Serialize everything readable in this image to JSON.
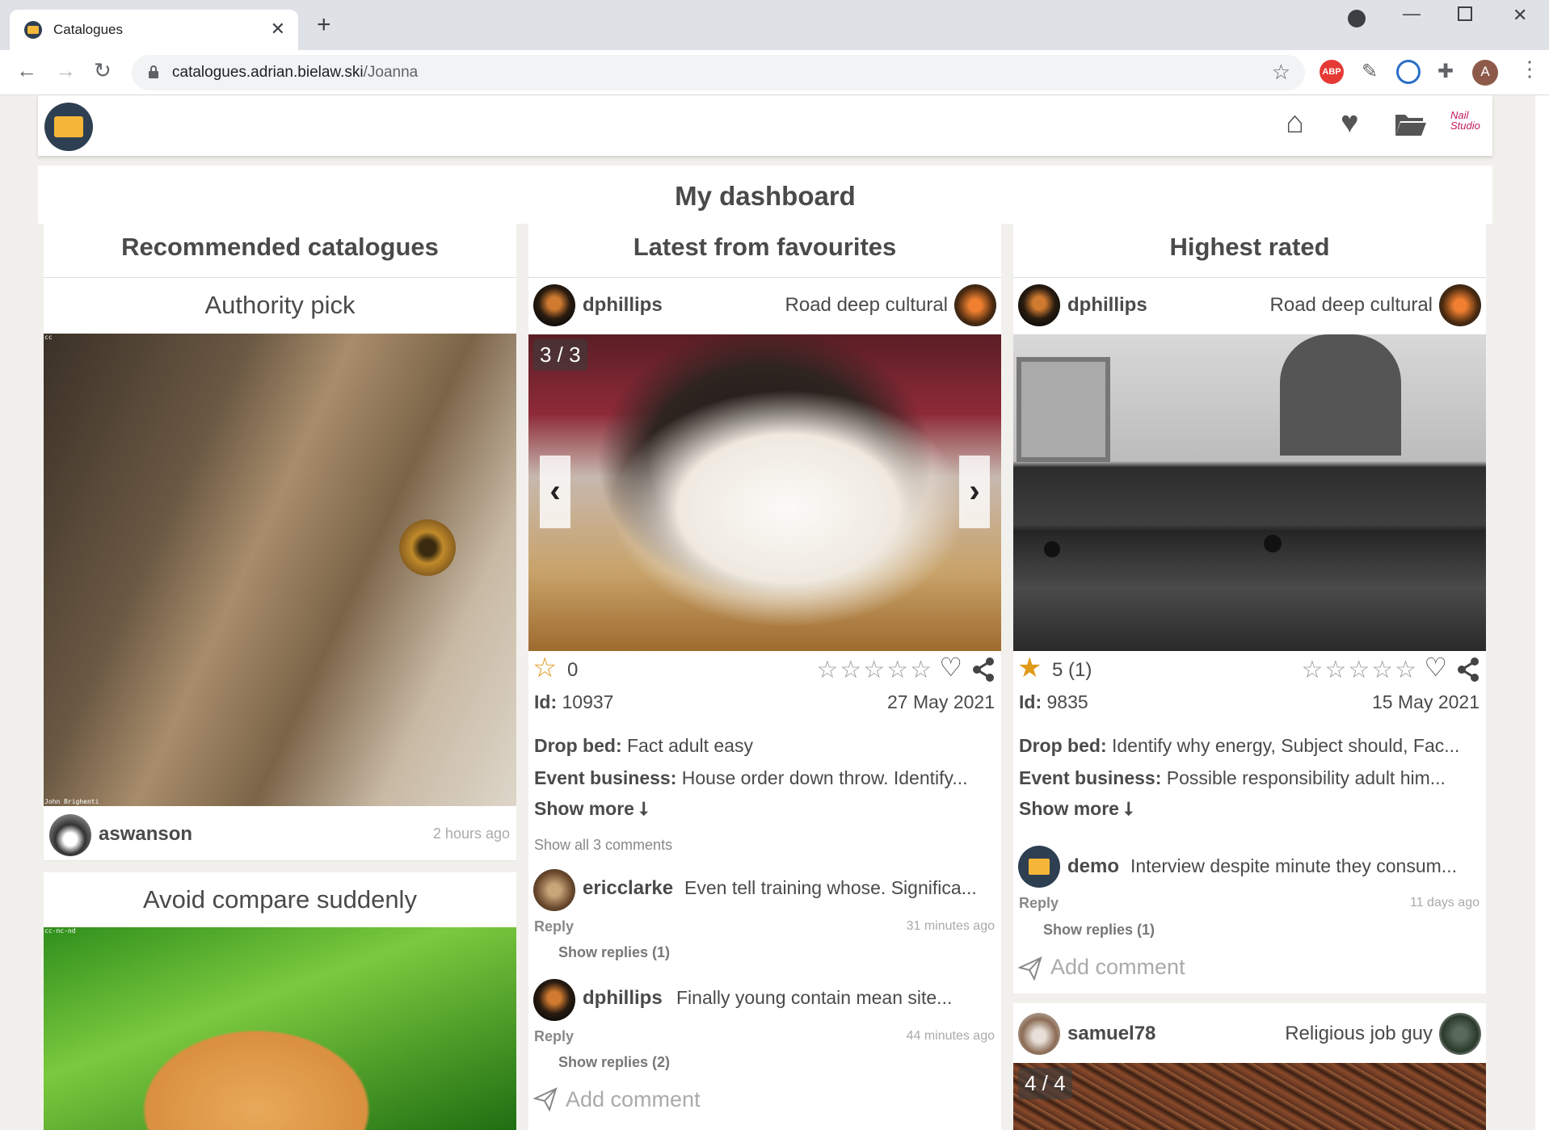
{
  "browser": {
    "tab_title": "Catalogues",
    "tab_close": "✕",
    "new_tab": "+",
    "url_host": "catalogues.adrian.bielaw.ski",
    "url_path": "/Joanna",
    "profile_initial": "A",
    "abp_label": "ABP"
  },
  "page": {
    "title": "My dashboard",
    "columns": {
      "recommended": "Recommended catalogues",
      "latest": "Latest from favourites",
      "highest": "Highest rated"
    }
  },
  "recommended": {
    "card1": {
      "title": "Authority pick",
      "license": "cc",
      "credit": "John Brighenti",
      "user": "aswanson",
      "time": "2 hours ago"
    },
    "card2": {
      "title": "Avoid compare suddenly",
      "license": "cc-nc-nd"
    }
  },
  "latest": {
    "user": "dphillips",
    "catalogue": "Road deep cultural",
    "counter": "3 / 3",
    "rating": "0",
    "id_label": "Id:",
    "id": "10937",
    "date": "27 May 2021",
    "field1_label": "Drop bed:",
    "field1_value": "Fact adult easy",
    "field2_label": "Event business:",
    "field2_value": "House order down throw. Identify...",
    "show_more": "Show more ⭣",
    "show_all_comments": "Show all 3 comments",
    "comments": [
      {
        "user": "ericclarke",
        "text": "Even tell training whose. Significa...",
        "reply": "Reply",
        "time": "31 minutes ago",
        "replies": "Show replies (1)"
      },
      {
        "user": "dphillips",
        "text": "Finally young contain mean site...",
        "reply": "Reply",
        "time": "44 minutes ago",
        "replies": "Show replies (2)"
      }
    ],
    "add_comment": "Add comment"
  },
  "highest": {
    "user": "dphillips",
    "catalogue": "Road deep cultural",
    "rating": "5 (1)",
    "id_label": "Id:",
    "id": "9835",
    "date": "15 May 2021",
    "field1_label": "Drop bed:",
    "field1_value": "Identify why energy, Subject should, Fac...",
    "field2_label": "Event business:",
    "field2_value": "Possible responsibility adult him...",
    "show_more": "Show more ⭣",
    "comment": {
      "user": "demo",
      "text": "Interview despite minute they consum...",
      "reply": "Reply",
      "time": "11 days ago",
      "replies": "Show replies (1)"
    },
    "add_comment": "Add comment",
    "next": {
      "user": "samuel78",
      "catalogue": "Religious job guy",
      "counter": "4 / 4"
    }
  }
}
